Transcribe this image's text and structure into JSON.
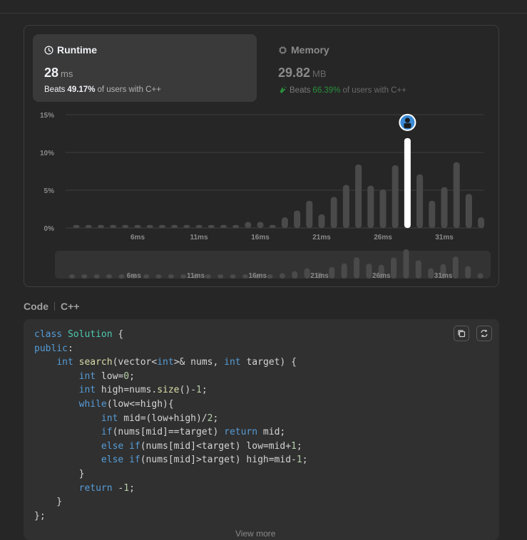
{
  "runtime": {
    "title": "Runtime",
    "value": "28",
    "unit": "ms",
    "beats_prefix": "Beats",
    "beats_pct": "49.17%",
    "beats_suffix": "of users with C++"
  },
  "memory": {
    "title": "Memory",
    "value": "29.82",
    "unit": "MB",
    "beats_prefix": "Beats",
    "beats_pct": "66.39%",
    "beats_suffix": "of users with C++"
  },
  "chart_data": {
    "type": "bar",
    "ylabel": "",
    "xlabel": "",
    "yticks": [
      "15%",
      "10%",
      "5%",
      "0%"
    ],
    "ylim": [
      0,
      15
    ],
    "xticks": [
      "6ms",
      "11ms",
      "16ms",
      "21ms",
      "26ms",
      "31ms"
    ],
    "xtick_bars": [
      5,
      10,
      15,
      20,
      25,
      30
    ],
    "values": [
      0.4,
      0.4,
      0.4,
      0.4,
      0.4,
      0.4,
      0.4,
      0.4,
      0.4,
      0.4,
      0.4,
      0.4,
      0.4,
      0.4,
      0.8,
      0.8,
      0.4,
      1.4,
      2.3,
      3.6,
      1.8,
      4.1,
      5.7,
      8.4,
      5.6,
      5.1,
      8.3,
      11.9,
      7.1,
      3.6,
      5.4,
      8.7,
      4.5,
      1.4
    ],
    "highlight_index": 27,
    "highlight_color": "#ffffff",
    "bar_color": "#4a4a4a",
    "grid": true
  },
  "code": {
    "label": "Code",
    "language": "C++",
    "view_more": "View more"
  },
  "colors": {
    "background": "#262626",
    "card": "#3a3a3a",
    "green": "#2a8f3c"
  }
}
